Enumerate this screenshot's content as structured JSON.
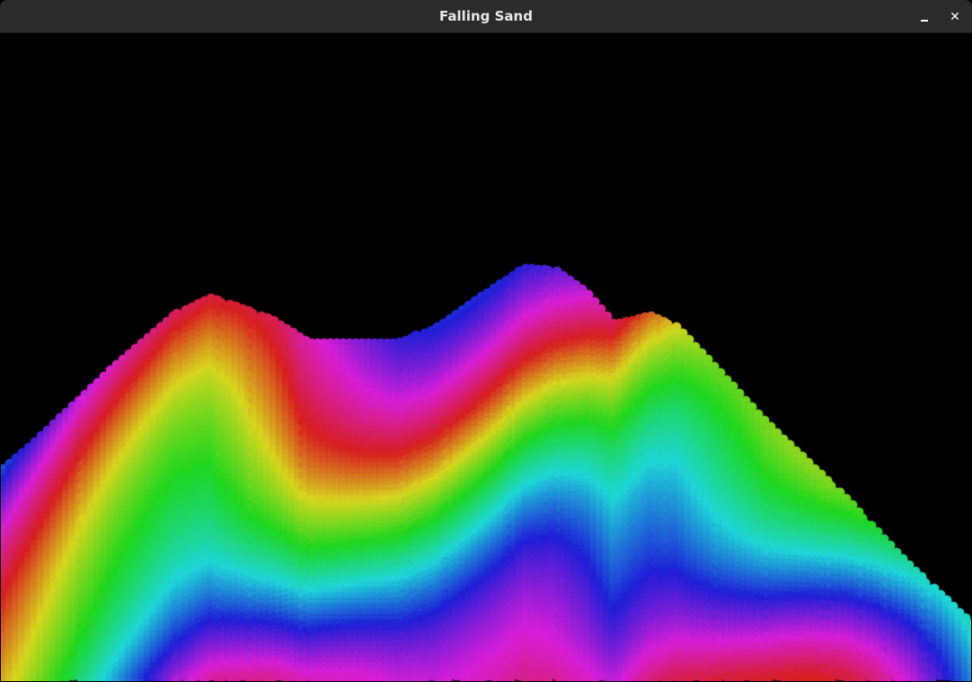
{
  "window": {
    "title": "Falling Sand"
  },
  "titlebar": {
    "minimize_icon": "minimize-icon",
    "close_icon": "close-icon",
    "close_label": "✕"
  },
  "sand": {
    "background": "#000000",
    "palette": "rainbow-hue-cycle"
  }
}
